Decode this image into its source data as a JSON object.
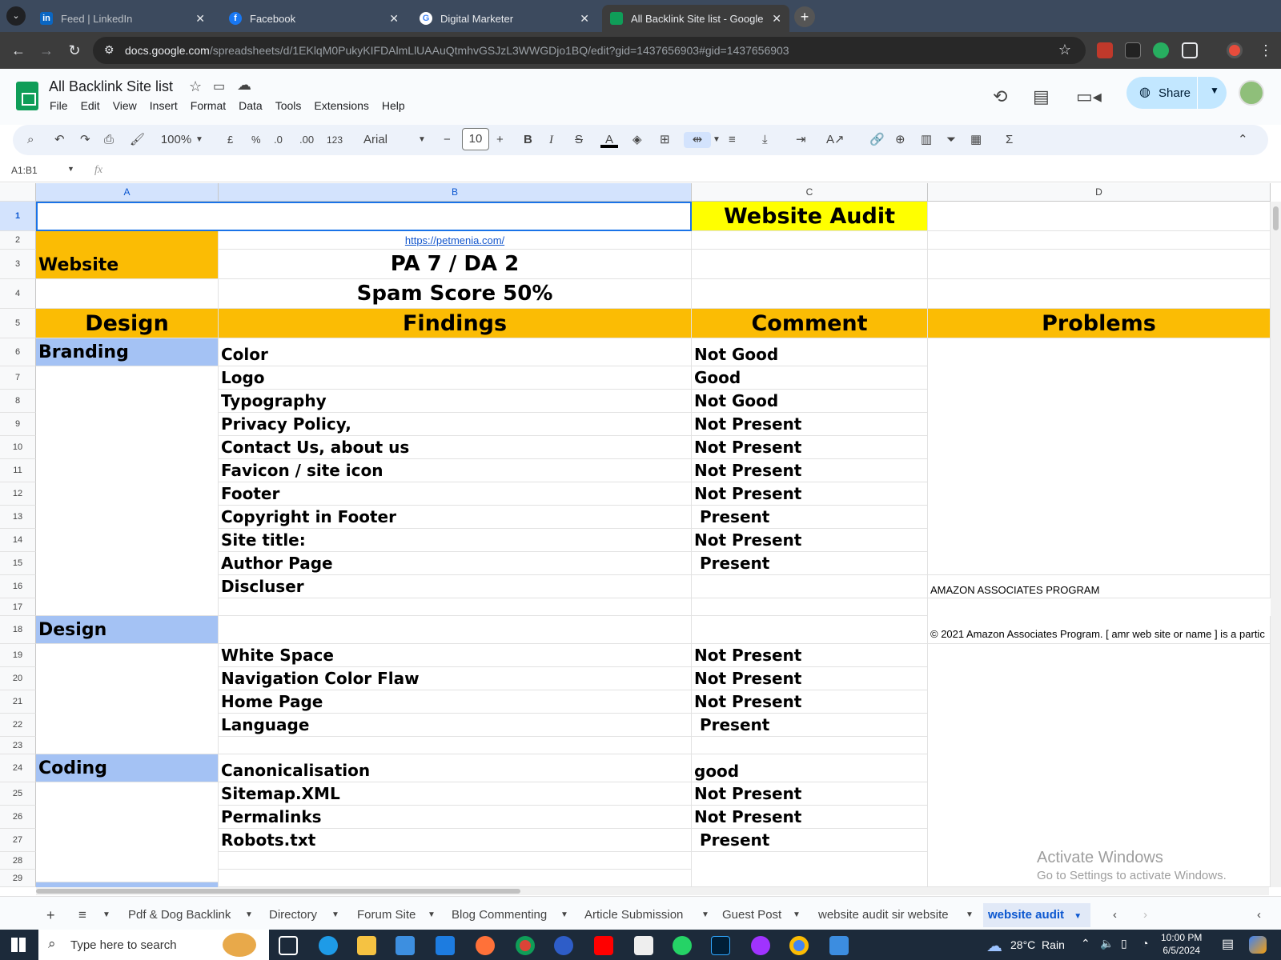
{
  "browser": {
    "tabs": [
      {
        "title": "Feed | LinkedIn",
        "icon": "in"
      },
      {
        "title": "Facebook",
        "icon": "f"
      },
      {
        "title": "Digital Marketer",
        "icon": "G"
      },
      {
        "title": "All Backlink Site list - Google Sh",
        "icon": ""
      }
    ],
    "url_host": "docs.google.com",
    "url_path": "/spreadsheets/d/1EKlqM0PukyKIFDAlmLlUAAuQtmhvGSJzL3WWGDjo1BQ/edit?gid=1437656903#gid=1437656903"
  },
  "doc": {
    "title": "All Backlink Site list",
    "menu": [
      "File",
      "Edit",
      "View",
      "Insert",
      "Format",
      "Data",
      "Tools",
      "Extensions",
      "Help"
    ],
    "share_label": "Share"
  },
  "toolbar": {
    "zoom": "100%",
    "currency": "£",
    "percent": "%",
    "dec_decrease": ".0",
    "dec_increase": ".00",
    "format_123": "123",
    "font": "Arial",
    "font_size": "10",
    "bold": "B",
    "italic": "I",
    "strike": "S",
    "text_color": "A",
    "sum": "Σ"
  },
  "formula_bar": {
    "name_box": "A1:B1",
    "fx": "fx"
  },
  "grid": {
    "columns": [
      "A",
      "B",
      "C",
      "D"
    ],
    "rows": [
      "1",
      "2",
      "3",
      "4",
      "5",
      "6",
      "7",
      "8",
      "9",
      "10",
      "11",
      "12",
      "13",
      "14",
      "15",
      "16",
      "17",
      "18",
      "19",
      "20",
      "21",
      "22",
      "23",
      "24",
      "25",
      "26",
      "27",
      "28",
      "29"
    ],
    "c1": "Website Audit",
    "b2_link": "https://petmenia.com/",
    "a3": "Website",
    "b3": "PA 7 / DA 2",
    "b4": "Spam Score 50%",
    "headers": {
      "a": "Design",
      "b": "Findings",
      "c": "Comment",
      "d": "Problems"
    },
    "sections": {
      "branding": "Branding",
      "design": "Design",
      "coding": "Coding"
    },
    "findings": [
      {
        "row": 6,
        "b": "Color",
        "c": "Not Good"
      },
      {
        "row": 7,
        "b": "Logo",
        "c": "Good"
      },
      {
        "row": 8,
        "b": "Typography",
        "c": "Not Good"
      },
      {
        "row": 9,
        "b": "Privacy Policy,",
        "c": "Not Present"
      },
      {
        "row": 10,
        "b": "Contact Us, about us",
        "c": "Not Present"
      },
      {
        "row": 11,
        "b": "Favicon / site icon",
        "c": "Not Present"
      },
      {
        "row": 12,
        "b": "Footer",
        "c": "Not Present"
      },
      {
        "row": 13,
        "b": "Copyright in Footer",
        "c": " Present"
      },
      {
        "row": 14,
        "b": "Site title:",
        "c": "Not Present"
      },
      {
        "row": 15,
        "b": "Author Page",
        "c": " Present"
      },
      {
        "row": 16,
        "b": "Discluser",
        "c": ""
      },
      {
        "row": 19,
        "b": "White Space",
        "c": "Not Present"
      },
      {
        "row": 20,
        "b": "Navigation Color Flaw",
        "c": "Not Present"
      },
      {
        "row": 21,
        "b": "Home Page",
        "c": "Not Present"
      },
      {
        "row": 22,
        "b": "Language",
        "c": " Present"
      },
      {
        "row": 24,
        "b": "Canonicalisation",
        "c": "good"
      },
      {
        "row": 25,
        "b": "Sitemap.XML",
        "c": "Not Present"
      },
      {
        "row": 26,
        "b": "Permalinks",
        "c": "Not Present"
      },
      {
        "row": 27,
        "b": "Robots.txt",
        "c": " Present"
      }
    ],
    "d16": "AMAZON ASSOCIATES PROGRAM",
    "d18": "© 2021 Amazon Associates Program. [ amr web site or name ] is a partic"
  },
  "sheets": [
    "Pdf & Dog Backlink",
    "Directory",
    "Forum Site",
    "Blog Commenting",
    "Article Submission",
    "Guest Post",
    "website audit sir website",
    "website audit"
  ],
  "watermark": {
    "line1": "Activate Windows",
    "line2": "Go to Settings to activate Windows."
  },
  "taskbar": {
    "search_placeholder": "Type here to search",
    "weather": "28°C  Rain",
    "time": "10:00 PM",
    "date": "6/5/2024"
  },
  "colors": {
    "orange": "#fbbc04",
    "yellow": "#ffff00",
    "blue": "#a4c2f4",
    "share": "#c2e7ff"
  }
}
